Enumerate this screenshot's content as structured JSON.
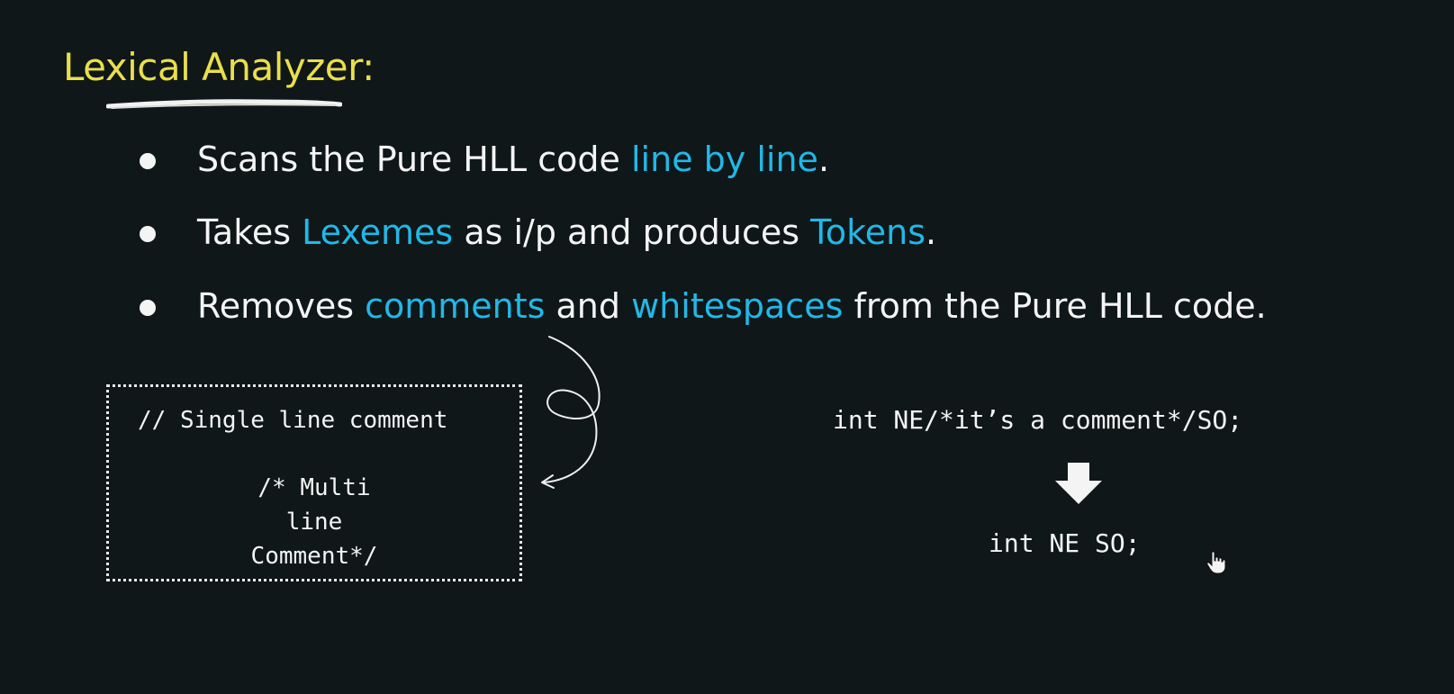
{
  "title": "Lexical Analyzer:",
  "bullets": [
    {
      "parts": [
        {
          "text": "Scans the Pure HLL code ",
          "highlight": false
        },
        {
          "text": "line by line",
          "highlight": true
        },
        {
          "text": ".",
          "highlight": false
        }
      ]
    },
    {
      "parts": [
        {
          "text": "Takes ",
          "highlight": false
        },
        {
          "text": "Lexemes",
          "highlight": true
        },
        {
          "text": " as i/p and produces ",
          "highlight": false
        },
        {
          "text": "Tokens",
          "highlight": true
        },
        {
          "text": ".",
          "highlight": false
        }
      ]
    },
    {
      "parts": [
        {
          "text": "Removes ",
          "highlight": false
        },
        {
          "text": "comments",
          "highlight": true
        },
        {
          "text": " and ",
          "highlight": false
        },
        {
          "text": "whitespaces",
          "highlight": true
        },
        {
          "text": " from the Pure HLL code.",
          "highlight": false
        }
      ]
    }
  ],
  "comment_box": {
    "single": "// Single line comment",
    "multi": [
      "/* Multi",
      "line",
      "Comment*/"
    ]
  },
  "example": {
    "before": "int NE/*it’s a comment*/SO;",
    "after": "int NE SO;"
  },
  "colors": {
    "title": "#e9df4a",
    "highlight": "#21b8e8",
    "text": "#f4f4f4",
    "background": "#0f1719"
  },
  "icons": {
    "down_arrow": "down-arrow-icon",
    "cursor": "hand-cursor-icon"
  }
}
